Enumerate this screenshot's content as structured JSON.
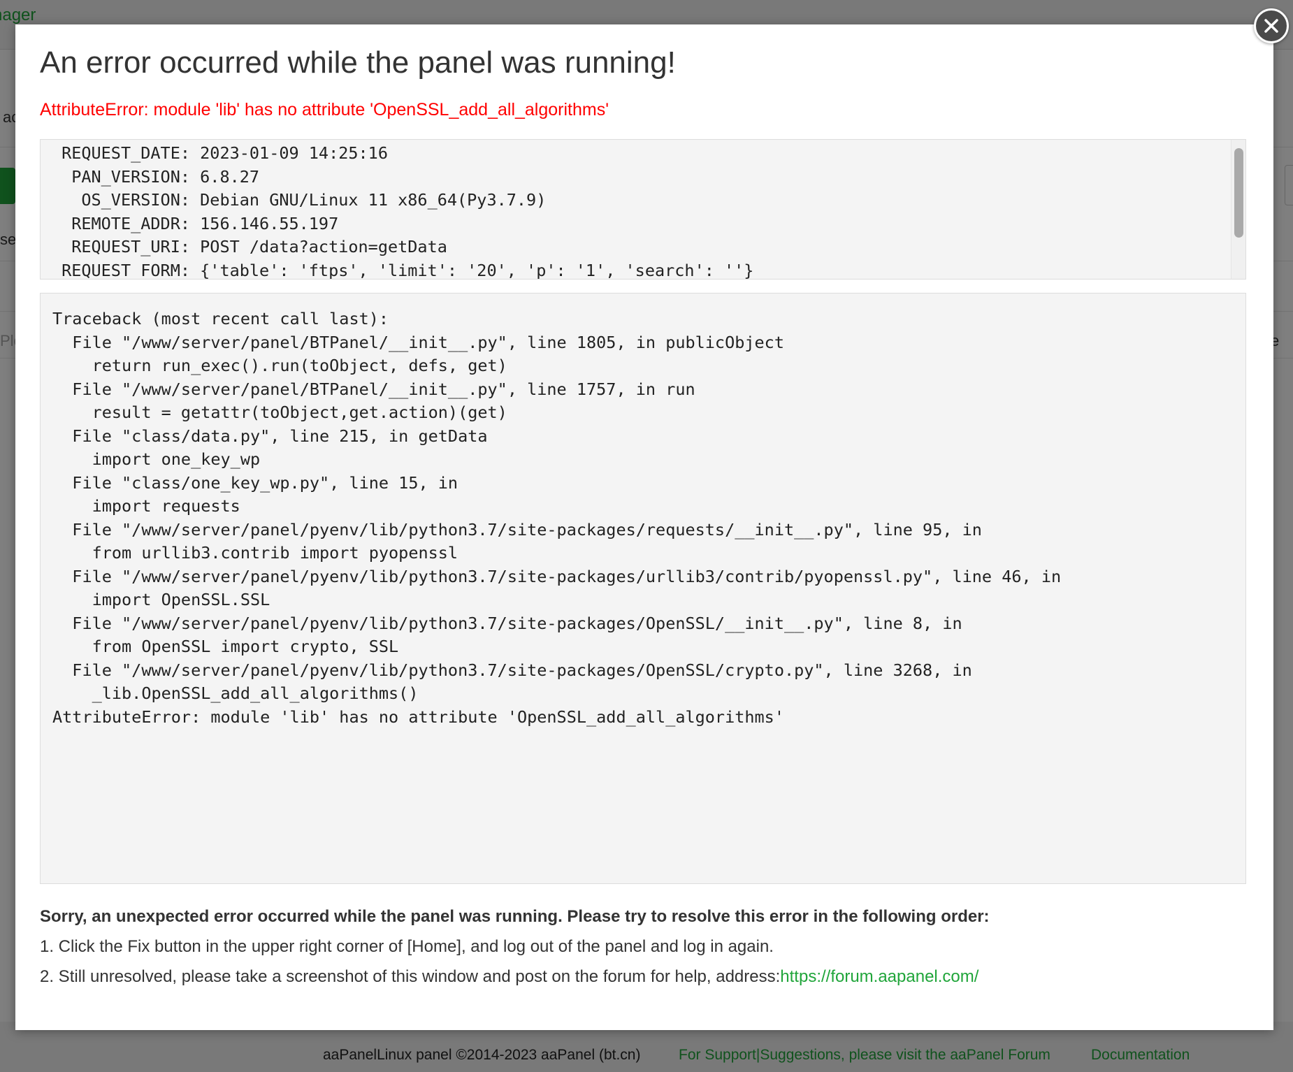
{
  "background": {
    "app_title_fragment": "nager",
    "row_fragments": [
      "ac",
      "se",
      "Ple",
      "e"
    ],
    "footer": {
      "copyright": "aaPanelLinux panel ©2014-2023 aaPanel (bt.cn)",
      "support_link": "For Support|Suggestions, please visit the aaPanel Forum",
      "docs_link": "Documentation"
    }
  },
  "dialog": {
    "title": "An error occurred while the panel was running!",
    "error_summary": "AttributeError: module 'lib' has no attribute 'OpenSSL_add_all_algorithms'",
    "request_info": [
      {
        "key": "REQUEST_DATE:",
        "value": "2023-01-09 14:25:16"
      },
      {
        "key": "PAN_VERSION:",
        "value": "6.8.27"
      },
      {
        "key": "OS_VERSION:",
        "value": "Debian GNU/Linux 11 x86_64(Py3.7.9)"
      },
      {
        "key": "REMOTE_ADDR:",
        "value": "156.146.55.197"
      },
      {
        "key": "REQUEST_URI:",
        "value": "POST /data?action=getData"
      },
      {
        "key": "REQUEST_FORM:",
        "value": "{'table': 'ftps', 'limit': '20', 'p': '1', 'search': ''}"
      }
    ],
    "traceback": [
      "Traceback (most recent call last):",
      "  File \"/www/server/panel/BTPanel/__init__.py\", line 1805, in publicObject",
      "    return run_exec().run(toObject, defs, get)",
      "  File \"/www/server/panel/BTPanel/__init__.py\", line 1757, in run",
      "    result = getattr(toObject,get.action)(get)",
      "  File \"class/data.py\", line 215, in getData",
      "    import one_key_wp",
      "  File \"class/one_key_wp.py\", line 15, in",
      "    import requests",
      "  File \"/www/server/panel/pyenv/lib/python3.7/site-packages/requests/__init__.py\", line 95, in",
      "    from urllib3.contrib import pyopenssl",
      "  File \"/www/server/panel/pyenv/lib/python3.7/site-packages/urllib3/contrib/pyopenssl.py\", line 46, in",
      "    import OpenSSL.SSL",
      "  File \"/www/server/panel/pyenv/lib/python3.7/site-packages/OpenSSL/__init__.py\", line 8, in",
      "    from OpenSSL import crypto, SSL",
      "  File \"/www/server/panel/pyenv/lib/python3.7/site-packages/OpenSSL/crypto.py\", line 3268, in",
      "    _lib.OpenSSL_add_all_algorithms()",
      "AttributeError: module 'lib' has no attribute 'OpenSSL_add_all_algorithms'"
    ],
    "help_heading": "Sorry, an unexpected error occurred while the panel was running. Please try to resolve this error in the following order:",
    "help_step_1": "1. Click the Fix button in the upper right corner of [Home], and log out of the panel and log in again.",
    "help_step_2_prefix": "2. Still unresolved, please take a screenshot of this window and post on the forum for help, address:",
    "help_step_2_link": "https://forum.aapanel.com/",
    "close_icon": "close-icon"
  },
  "colors": {
    "error_red": "#ff0000",
    "link_green": "#20a53a",
    "close_button": "#4a4a4a"
  }
}
